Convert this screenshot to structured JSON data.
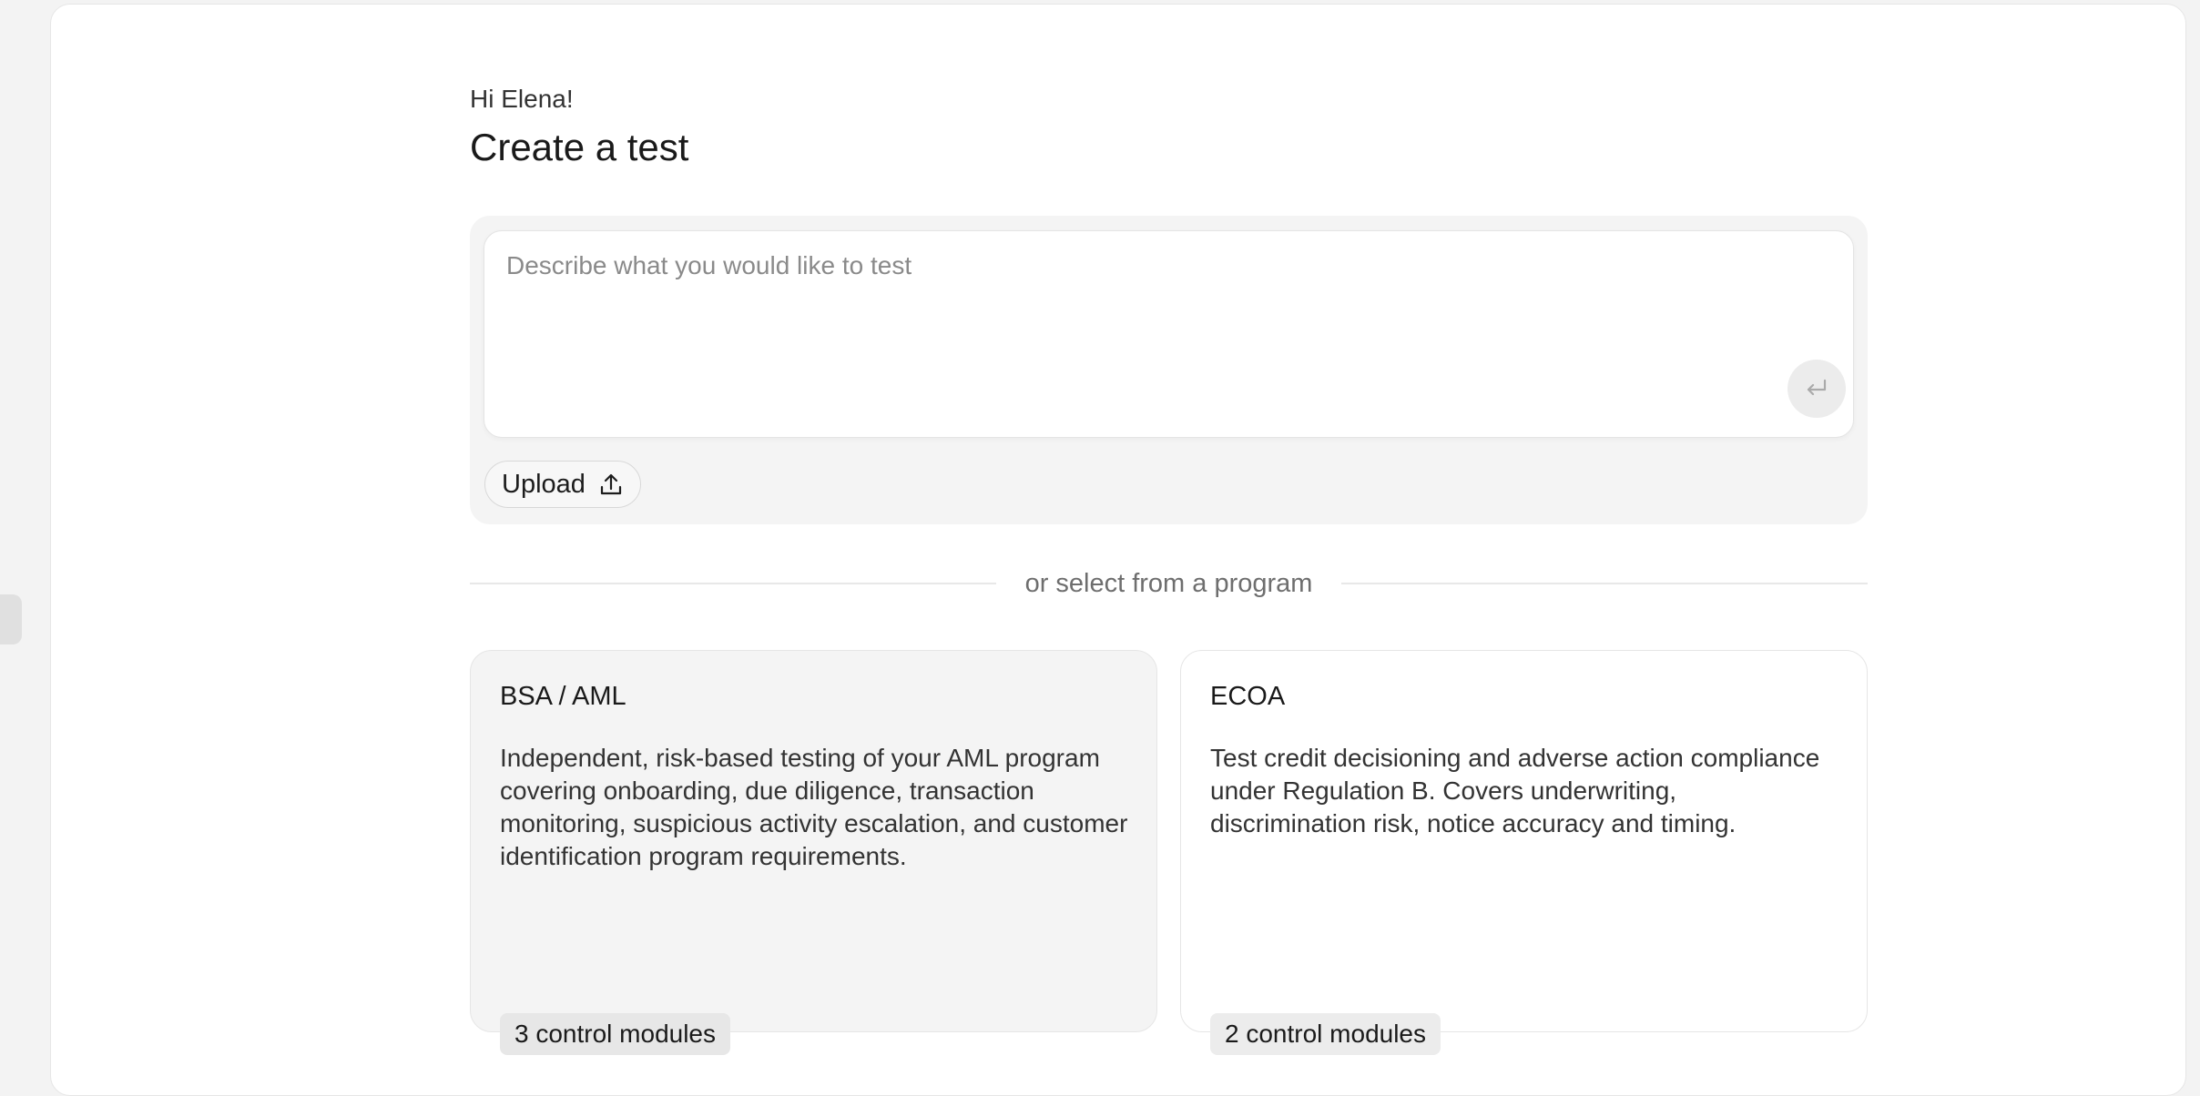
{
  "header": {
    "greeting": "Hi Elena!",
    "title": "Create a test"
  },
  "composer": {
    "placeholder": "Describe what you would like to test",
    "value": "",
    "send_icon": "enter-return-icon",
    "upload_label": "Upload",
    "upload_icon": "upload-icon"
  },
  "divider": {
    "text": "or select from a program"
  },
  "programs": [
    {
      "title": "BSA / AML",
      "description": "Independent, risk-based testing of your AML program covering onboarding, due diligence, transaction monitoring, suspicious activity escalation, and customer identification program requirements.",
      "badge": "3 control modules"
    },
    {
      "title": "ECOA",
      "description": "Test credit decisioning and adverse action compliance under Regulation B. Covers underwriting, discrimination risk, notice accuracy and timing.",
      "badge": "2 control modules"
    }
  ]
}
